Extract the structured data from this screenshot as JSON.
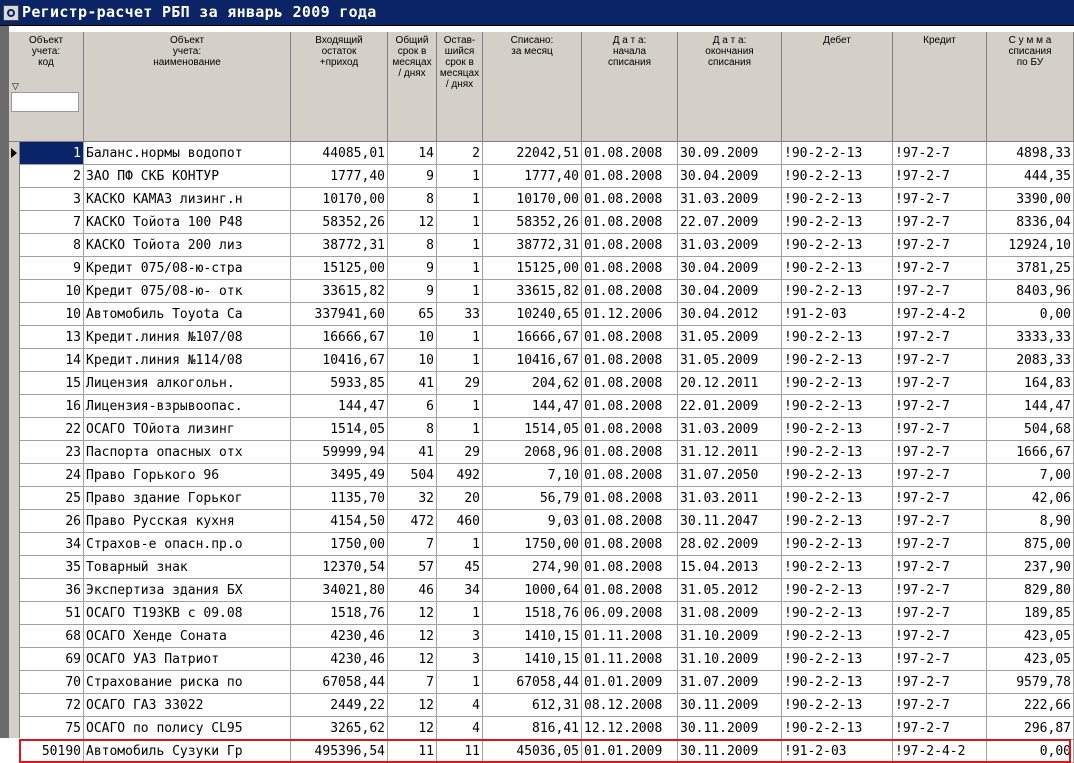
{
  "window": {
    "icon": "app-icon",
    "title": "Регистр-расчет РБП  за январь 2009 года"
  },
  "columns": [
    "Объект\nучета:\nкод",
    "Объект\nучета:\nнаименование",
    "Входящий\nостаток\n+приход",
    "Общий\nсрок в\nмесяцах\n/ днях",
    "Остав-\nшийся\nсрок в\nмесяцах\n/ днях",
    "Списано:\nза месяц",
    "Д а т а:\nначала\nсписания",
    "Д а т а:\nокончания\nсписания",
    "Дебет",
    "Кредит",
    "С у м м а\nсписания\nпо БУ"
  ],
  "rows": [
    [
      "1",
      "Баланс.нормы водопот",
      "44085,01",
      "14",
      "2",
      "22042,51",
      "01.08.2008",
      "30.09.2009",
      "!90-2-2-13",
      "!97-2-7",
      "4898,33"
    ],
    [
      "2",
      "ЗАО ПФ СКБ КОНТУР",
      "1777,40",
      "9",
      "1",
      "1777,40",
      "01.08.2008",
      "30.04.2009",
      "!90-2-2-13",
      "!97-2-7",
      "444,35"
    ],
    [
      "3",
      "КАСКО КАМАЗ лизинг.н",
      "10170,00",
      "8",
      "1",
      "10170,00",
      "01.08.2008",
      "31.03.2009",
      "!90-2-2-13",
      "!97-2-7",
      "3390,00"
    ],
    [
      "7",
      "КАСКО Тойота 100 Р48",
      "58352,26",
      "12",
      "1",
      "58352,26",
      "01.08.2008",
      "22.07.2009",
      "!90-2-2-13",
      "!97-2-7",
      "8336,04"
    ],
    [
      "8",
      "КАСКО Тойота 200 лиз",
      "38772,31",
      "8",
      "1",
      "38772,31",
      "01.08.2008",
      "31.03.2009",
      "!90-2-2-13",
      "!97-2-7",
      "12924,10"
    ],
    [
      "9",
      "Кредит 075/08-ю-стра",
      "15125,00",
      "9",
      "1",
      "15125,00",
      "01.08.2008",
      "30.04.2009",
      "!90-2-2-13",
      "!97-2-7",
      "3781,25"
    ],
    [
      "10",
      "Кредит 075/08-ю- отк",
      "33615,82",
      "9",
      "1",
      "33615,82",
      "01.08.2008",
      "30.04.2009",
      "!90-2-2-13",
      "!97-2-7",
      "8403,96"
    ],
    [
      "10",
      "Автомобиль Toyota Ca",
      "337941,60",
      "65",
      "33",
      "10240,65",
      "01.12.2006",
      "30.04.2012",
      "!91-2-03",
      "!97-2-4-2",
      "0,00"
    ],
    [
      "13",
      "Кредит.линия №107/08",
      "16666,67",
      "10",
      "1",
      "16666,67",
      "01.08.2008",
      "31.05.2009",
      "!90-2-2-13",
      "!97-2-7",
      "3333,33"
    ],
    [
      "14",
      "Кредит.линия №114/08",
      "10416,67",
      "10",
      "1",
      "10416,67",
      "01.08.2008",
      "31.05.2009",
      "!90-2-2-13",
      "!97-2-7",
      "2083,33"
    ],
    [
      "15",
      "Лицензия алкогольн.",
      "5933,85",
      "41",
      "29",
      "204,62",
      "01.08.2008",
      "20.12.2011",
      "!90-2-2-13",
      "!97-2-7",
      "164,83"
    ],
    [
      "16",
      "Лицензия-взрывоопас.",
      "144,47",
      "6",
      "1",
      "144,47",
      "01.08.2008",
      "22.01.2009",
      "!90-2-2-13",
      "!97-2-7",
      "144,47"
    ],
    [
      "22",
      "ОСАГО ТОйота лизинг",
      "1514,05",
      "8",
      "1",
      "1514,05",
      "01.08.2008",
      "31.03.2009",
      "!90-2-2-13",
      "!97-2-7",
      "504,68"
    ],
    [
      "23",
      "Паспорта опасных отх",
      "59999,94",
      "41",
      "29",
      "2068,96",
      "01.08.2008",
      "31.12.2011",
      "!90-2-2-13",
      "!97-2-7",
      "1666,67"
    ],
    [
      "24",
      "Право Горького 96",
      "3495,49",
      "504",
      "492",
      "7,10",
      "01.08.2008",
      "31.07.2050",
      "!90-2-2-13",
      "!97-2-7",
      "7,00"
    ],
    [
      "25",
      "Право здание Горьког",
      "1135,70",
      "32",
      "20",
      "56,79",
      "01.08.2008",
      "31.03.2011",
      "!90-2-2-13",
      "!97-2-7",
      "42,06"
    ],
    [
      "26",
      "Право Русская кухня",
      "4154,50",
      "472",
      "460",
      "9,03",
      "01.08.2008",
      "30.11.2047",
      "!90-2-2-13",
      "!97-2-7",
      "8,90"
    ],
    [
      "34",
      "Страхов-е опасн.пр.о",
      "1750,00",
      "7",
      "1",
      "1750,00",
      "01.08.2008",
      "28.02.2009",
      "!90-2-2-13",
      "!97-2-7",
      "875,00"
    ],
    [
      "35",
      "Товарный знак",
      "12370,54",
      "57",
      "45",
      "274,90",
      "01.08.2008",
      "15.04.2013",
      "!90-2-2-13",
      "!97-2-7",
      "237,90"
    ],
    [
      "36",
      "Экспертиза здания БХ",
      "34021,80",
      "46",
      "34",
      "1000,64",
      "01.08.2008",
      "31.05.2012",
      "!90-2-2-13",
      "!97-2-7",
      "829,80"
    ],
    [
      "51",
      "ОСАГО Т193КВ с 09.08",
      "1518,76",
      "12",
      "1",
      "1518,76",
      "06.09.2008",
      "31.08.2009",
      "!90-2-2-13",
      "!97-2-7",
      "189,85"
    ],
    [
      "68",
      "ОСАГО Хенде Соната",
      "4230,46",
      "12",
      "3",
      "1410,15",
      "01.11.2008",
      "31.10.2009",
      "!90-2-2-13",
      "!97-2-7",
      "423,05"
    ],
    [
      "69",
      "ОСАГО УАЗ Патриот",
      "4230,46",
      "12",
      "3",
      "1410,15",
      "01.11.2008",
      "31.10.2009",
      "!90-2-2-13",
      "!97-2-7",
      "423,05"
    ],
    [
      "70",
      "Страхование риска по",
      "67058,44",
      "7",
      "1",
      "67058,44",
      "01.01.2009",
      "31.07.2009",
      "!90-2-2-13",
      "!97-2-7",
      "9579,78"
    ],
    [
      "72",
      "ОСАГО ГАЗ 33022",
      "2449,22",
      "12",
      "4",
      "612,31",
      "08.12.2008",
      "30.11.2009",
      "!90-2-2-13",
      "!97-2-7",
      "222,66"
    ],
    [
      "75",
      "ОСАГО по полису CL95",
      "3265,62",
      "12",
      "4",
      "816,41",
      "12.12.2008",
      "30.11.2009",
      "!90-2-2-13",
      "!97-2-7",
      "296,87"
    ],
    [
      "50190",
      "Автомобиль Сузуки Гр",
      "495396,54",
      "11",
      "11",
      "45036,05",
      "01.01.2009",
      "30.11.2009",
      "!91-2-03",
      "!97-2-4-2",
      "0,00"
    ]
  ],
  "selected_row": 0,
  "highlighted_row": 26,
  "colors": {
    "titlebar": "#0a2466",
    "selection": "#0a246a",
    "highlight_border": "#e0141a",
    "header_bg": "#d4d0c8"
  }
}
